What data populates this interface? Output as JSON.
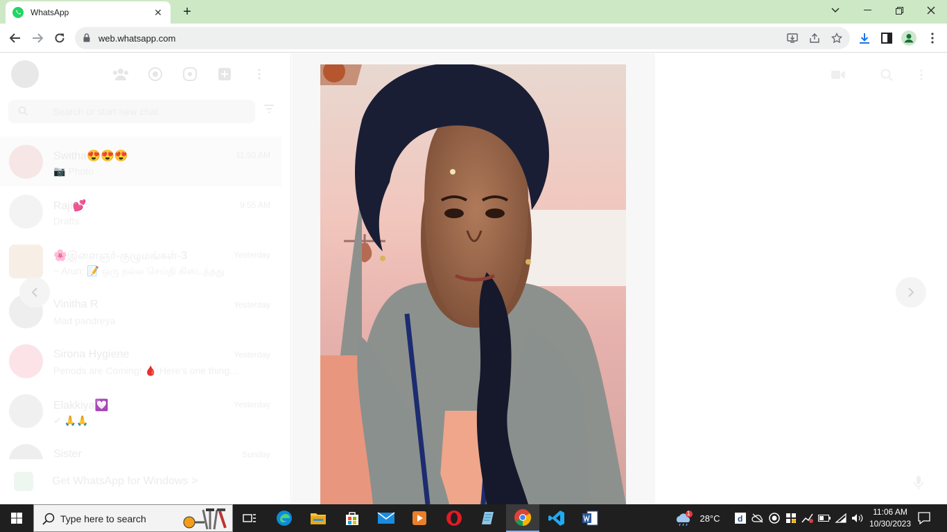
{
  "browser": {
    "tab_title": "WhatsApp",
    "url": "web.whatsapp.com"
  },
  "sidebar": {
    "search_placeholder": "Search or start new chat",
    "chats": [
      {
        "name": "Switha😍😍😍",
        "message": "📷 Photo",
        "time": "11:50 AM"
      },
      {
        "name": "Raji💕",
        "message": "Drafts",
        "time": "9:55 AM"
      },
      {
        "name": "🌸இளைஞர்-குழுமங்கள்-3",
        "message": "~ Arun: 📝 ஒரு நல்ல செய்தி கிடைத்தது",
        "time": "Yesterday"
      },
      {
        "name": "Vinitha R",
        "message": "Mad pandreya",
        "time": "Yesterday"
      },
      {
        "name": "Sirona Hygiene",
        "message": "Periods are Coming! 🩸 Here's one thing...",
        "time": "Yesterday"
      },
      {
        "name": "Elakkiya💟",
        "message": "✔ 🙏🙏",
        "time": "Yesterday"
      },
      {
        "name": "Sister",
        "message": "",
        "time": "Sunday"
      }
    ],
    "get_app": "Get WhatsApp for Windows >"
  },
  "taskbar": {
    "search_placeholder": "Type here to search",
    "weather": "28°C",
    "weather_badge": "1",
    "time": "11:06 AM",
    "date": "10/30/2023"
  },
  "colors": {
    "tabstrip": "#cde8c4",
    "whatsapp_green": "#25d366",
    "taskbar": "#1f1f1f"
  }
}
